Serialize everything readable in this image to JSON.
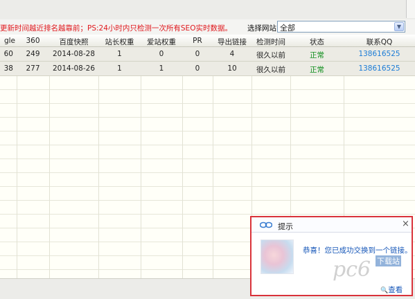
{
  "notice": {
    "text": "更新时间越近排名越靠前；PS:24小时内只检测一次所有SEO实时数据。",
    "site_label": "选择网站：",
    "site_value": "全部"
  },
  "table": {
    "headers": [
      "gle",
      "360",
      "百度快照",
      "站长权重",
      "爱站权重",
      "PR",
      "导出链接",
      "检测时间",
      "状态",
      "联系QQ"
    ],
    "rows": [
      [
        "60",
        "249",
        "2014-08-28",
        "1",
        "0",
        "0",
        "4",
        "很久以前",
        "正常",
        "138616525"
      ],
      [
        "38",
        "277",
        "2014-08-26",
        "1",
        "1",
        "0",
        "10",
        "很久以前",
        "正常",
        "138616525"
      ]
    ]
  },
  "popup": {
    "title": "提示",
    "close": "×",
    "message": "恭喜！您已成功交换到一个链接。",
    "view": "查看"
  },
  "watermark": {
    "text": "pc6",
    "badge": "下载站"
  },
  "colors": {
    "notice_red": "#e0181d",
    "status_green": "#108f1d",
    "qq_blue": "#1a7bd6",
    "popup_border": "#d9323a"
  }
}
